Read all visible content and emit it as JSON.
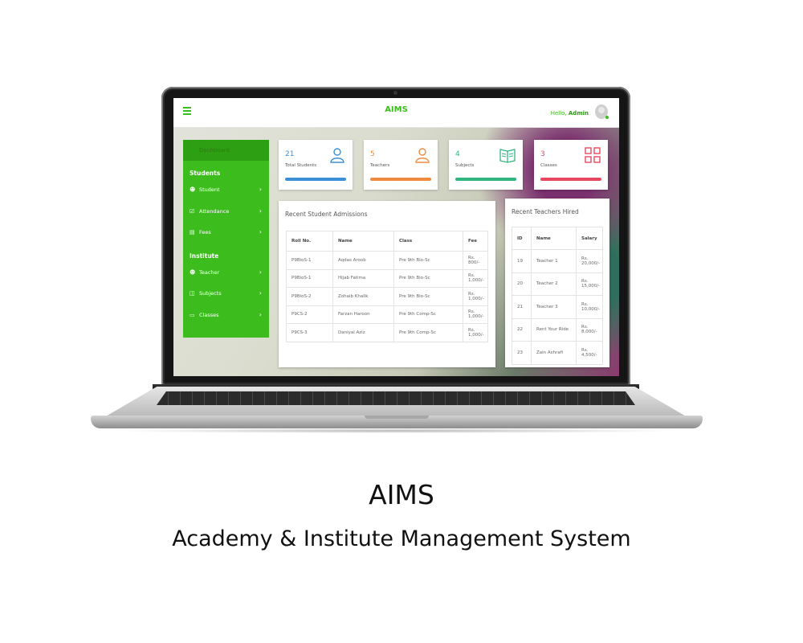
{
  "app": {
    "title": "AIMS",
    "greeting": "Hello,",
    "user": "Admin"
  },
  "sidebar": {
    "dashboard_label": "Dashboard",
    "sections": [
      {
        "title": "Students",
        "items": [
          {
            "label": "Student",
            "icon": "person-icon"
          },
          {
            "label": "Attendance",
            "icon": "calendar-check-icon"
          },
          {
            "label": "Fees",
            "icon": "money-icon"
          }
        ]
      },
      {
        "title": "Institute",
        "items": [
          {
            "label": "Teacher",
            "icon": "person-icon"
          },
          {
            "label": "Subjects",
            "icon": "book-icon"
          },
          {
            "label": "Classes",
            "icon": "monitor-icon"
          }
        ]
      }
    ]
  },
  "stats": [
    {
      "value": "21",
      "label": "Total Students",
      "icon": "users-icon",
      "color": "#3a8fd6"
    },
    {
      "value": "5",
      "label": "Teachers",
      "icon": "user-icon",
      "color": "#f08a3e"
    },
    {
      "value": "4",
      "label": "Subjects",
      "icon": "open-book-icon",
      "color": "#2fb67f"
    },
    {
      "value": "3",
      "label": "Classes",
      "icon": "grid-icon",
      "color": "#e8485f"
    }
  ],
  "admissions": {
    "title": "Recent Student Admissions",
    "columns": [
      "Roll No.",
      "Name",
      "Class",
      "Fee"
    ],
    "rows": [
      [
        "P9BioS-1",
        "Aqdas Aroob",
        "Pre 9th Bio-Sc",
        "Rs. 800/-"
      ],
      [
        "P9BioS-1",
        "Hijab Fatima",
        "Pre 9th Bio-Sc",
        "Rs. 1,000/-"
      ],
      [
        "P9BioS-2",
        "Zohaib Khalik",
        "Pre 9th Bio-Sc",
        "Rs. 1,000/-"
      ],
      [
        "P9CS-2",
        "Farzan Haroon",
        "Pre 9th Comp-Sc",
        "Rs. 1,000/-"
      ],
      [
        "P9CS-3",
        "Daniyal Aziz",
        "Pre 9th Comp-Sc",
        "Rs. 1,000/-"
      ]
    ]
  },
  "teachers": {
    "title": "Recent Teachers Hired",
    "columns": [
      "ID",
      "Name",
      "Salary"
    ],
    "rows": [
      [
        "19",
        "Teacher 1",
        "Rs. 20,000/-"
      ],
      [
        "20",
        "Teacher 2",
        "Rs. 15,000/-"
      ],
      [
        "21",
        "Teacher 3",
        "Rs. 10,000/-"
      ],
      [
        "22",
        "Rent Your Ride",
        "Rs. 8,000/-"
      ],
      [
        "23",
        "Zain Ashrafi",
        "Rs. 4,500/-"
      ]
    ]
  },
  "caption": {
    "title": "AIMS",
    "subtitle": "Academy & Institute Management System"
  }
}
